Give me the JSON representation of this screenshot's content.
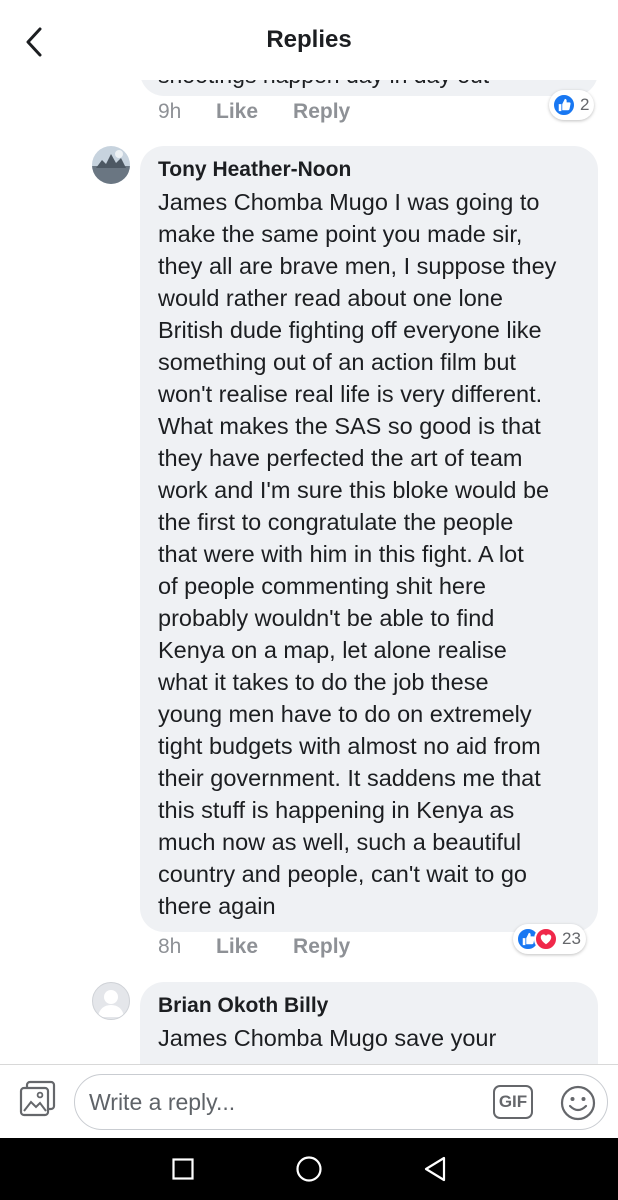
{
  "header": {
    "title": "Replies"
  },
  "previous_comment": {
    "clipped_text": "shootings happen day in day out",
    "time": "9h",
    "like_label": "Like",
    "reply_label": "Reply",
    "reaction_count": "2"
  },
  "comments": [
    {
      "author": "Tony Heather-Noon",
      "text": "James Chomba Mugo I was going to\nmake the same point you made sir,\nthey all are brave men, I suppose they\nwould rather read about one lone\nBritish dude fighting off everyone like\nsomething out of an action film but\nwon't realise real life is very different.\nWhat makes the SAS so good is that\nthey have perfected the art of team\nwork and I'm sure this bloke would be\nthe first to congratulate the people\nthat were with him in this fight. A lot\nof people commenting shit here\nprobably wouldn't be able to find\nKenya on a map, let alone realise\nwhat it takes to do the job these\nyoung men have to do on extremely\ntight budgets with almost no aid from\ntheir government. It saddens me that\nthis stuff is happening in Kenya as\nmuch now as well, such a beautiful\ncountry and people, can't wait to go\nthere again",
      "time": "8h",
      "like_label": "Like",
      "reply_label": "Reply",
      "reaction_count": "23"
    },
    {
      "author": "Brian Okoth Billy",
      "text": "James Chomba Mugo save your"
    }
  ],
  "composer": {
    "placeholder": "Write a reply...",
    "gif_label": "GIF"
  },
  "colors": {
    "bubble": "#eff1f4",
    "like_blue": "#1877f2",
    "love_red": "#f0284a",
    "meta_gray": "#8e9196"
  },
  "icons": [
    "back-arrow-icon",
    "like-icon",
    "love-icon",
    "photo-icon",
    "emoji-icon",
    "square-icon",
    "circle-icon",
    "triangle-back-icon"
  ]
}
